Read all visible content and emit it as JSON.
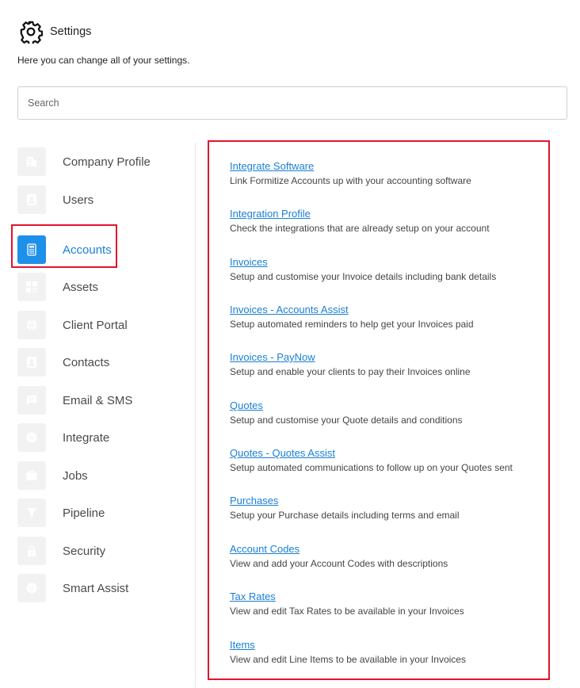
{
  "header": {
    "title": "Settings",
    "subtitle": "Here you can change all of your settings."
  },
  "search": {
    "placeholder": "Search"
  },
  "colors": {
    "accent": "#1e90ea",
    "link": "#1a7fd6",
    "highlight": "#e3132b"
  },
  "sidebar": {
    "items": [
      {
        "label": "Company Profile",
        "icon": "building-icon"
      },
      {
        "label": "Users",
        "icon": "user-icon"
      },
      {
        "label": "Accounts",
        "icon": "calculator-icon",
        "active": true
      },
      {
        "label": "Assets",
        "icon": "qr-code-icon"
      },
      {
        "label": "Client Portal",
        "icon": "globe-icon"
      },
      {
        "label": "Contacts",
        "icon": "contact-card-icon"
      },
      {
        "label": "Email & SMS",
        "icon": "message-icon"
      },
      {
        "label": "Integrate",
        "icon": "plug-icon"
      },
      {
        "label": "Jobs",
        "icon": "briefcase-icon"
      },
      {
        "label": "Pipeline",
        "icon": "funnel-icon"
      },
      {
        "label": "Security",
        "icon": "lock-icon"
      },
      {
        "label": "Smart Assist",
        "icon": "robot-icon"
      }
    ]
  },
  "main": {
    "entries": [
      {
        "title": "Integrate Software",
        "description": "Link Formitize Accounts up with your accounting software"
      },
      {
        "title": "Integration Profile",
        "description": "Check the integrations that are already setup on your account"
      },
      {
        "title": "Invoices",
        "description": "Setup and customise your Invoice details including bank details"
      },
      {
        "title": "Invoices - Accounts Assist",
        "description": "Setup automated reminders to help get your Invoices paid"
      },
      {
        "title": "Invoices - PayNow",
        "description": "Setup and enable your clients to pay their Invoices online"
      },
      {
        "title": "Quotes",
        "description": "Setup and customise your Quote details and conditions"
      },
      {
        "title": "Quotes - Quotes Assist",
        "description": "Setup automated communications to follow up on your Quotes sent"
      },
      {
        "title": "Purchases",
        "description": "Setup your Purchase details including terms and email"
      },
      {
        "title": "Account Codes",
        "description": "View and add your Account Codes with descriptions"
      },
      {
        "title": "Tax Rates",
        "description": "View and edit Tax Rates to be available in your Invoices"
      },
      {
        "title": "Items",
        "description": "View and edit Line Items to be available in your Invoices"
      }
    ]
  }
}
